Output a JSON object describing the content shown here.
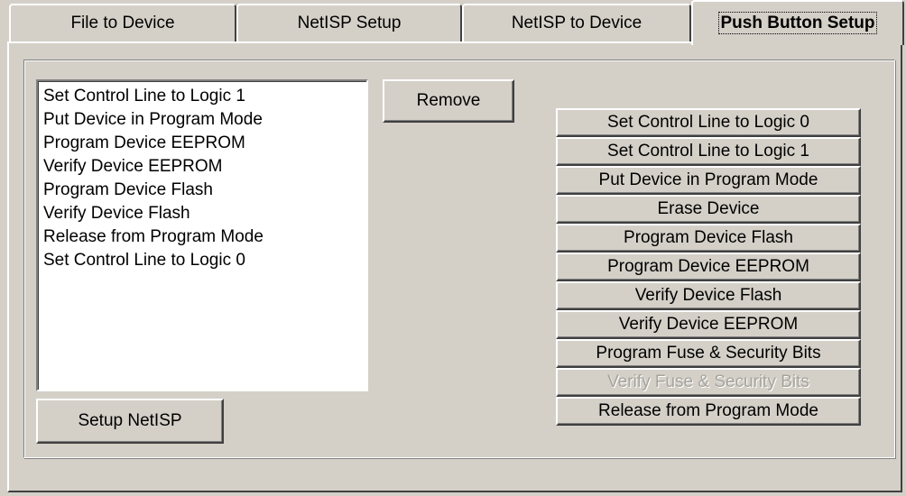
{
  "tabs": [
    {
      "label": "File to Device"
    },
    {
      "label": "NetISP Setup"
    },
    {
      "label": "NetISP to Device"
    },
    {
      "label": "Push Button Setup",
      "active": true
    }
  ],
  "sequence_list": {
    "items": [
      "Set Control Line to Logic 1",
      "Put Device in Program Mode",
      "Program Device EEPROM",
      "Verify Device EEPROM",
      "Program Device Flash",
      "Verify Device Flash",
      "Release from Program Mode",
      "Set Control Line to Logic 0"
    ]
  },
  "buttons": {
    "remove": "Remove",
    "setup_netisp": "Setup NetISP"
  },
  "commands": [
    {
      "label": "Set Control Line to Logic 0",
      "enabled": true
    },
    {
      "label": "Set Control Line to Logic 1",
      "enabled": true
    },
    {
      "label": "Put Device in Program Mode",
      "enabled": true
    },
    {
      "label": "Erase Device",
      "enabled": true
    },
    {
      "label": "Program Device Flash",
      "enabled": true
    },
    {
      "label": "Program Device EEPROM",
      "enabled": true
    },
    {
      "label": "Verify Device Flash",
      "enabled": true
    },
    {
      "label": "Verify Device EEPROM",
      "enabled": true
    },
    {
      "label": "Program Fuse & Security Bits",
      "enabled": true
    },
    {
      "label": "Verify Fuse & Security Bits",
      "enabled": false
    },
    {
      "label": "Release from Program Mode",
      "enabled": true
    }
  ]
}
